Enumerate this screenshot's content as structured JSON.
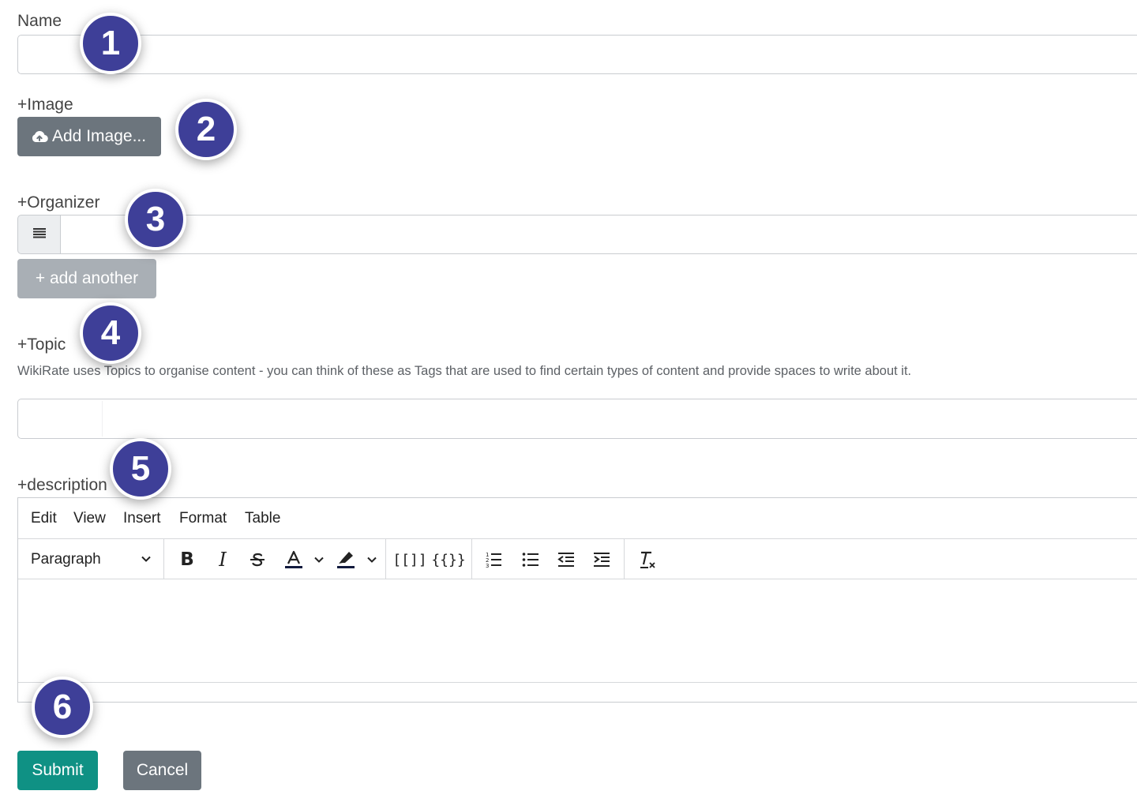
{
  "fields": {
    "name": {
      "label": "Name",
      "value": ""
    },
    "image": {
      "label": "+Image",
      "button_label": "Add Image..."
    },
    "organizer": {
      "label": "+Organizer",
      "value": "",
      "add_another_label": "+ add another"
    },
    "topic": {
      "label": "+Topic",
      "help_text": "WikiRate uses Topics to organise content - you can think of these as Tags that are used to find certain types of content and provide spaces to write about it.",
      "value": ""
    },
    "description": {
      "label": "+description"
    }
  },
  "editor": {
    "menu": [
      "Edit",
      "View",
      "Insert",
      "Format",
      "Table"
    ],
    "block_format": "Paragraph",
    "toolbar_icons": [
      "bold-icon",
      "italic-icon",
      "strikethrough-icon",
      "text-color-icon",
      "highlight-color-icon",
      "wiki-link-icon",
      "nest-icon",
      "numbered-list-icon",
      "bullet-list-icon",
      "outdent-icon",
      "indent-icon",
      "clear-formatting-icon"
    ],
    "link_label": "[[]]",
    "nest_label": "{{}}",
    "content": ""
  },
  "actions": {
    "submit_label": "Submit",
    "cancel_label": "Cancel"
  },
  "badges": [
    "1",
    "2",
    "3",
    "4",
    "5",
    "6"
  ],
  "colors": {
    "badge": "#3e3f98",
    "submit": "#0f9184",
    "cancel": "#6c757d",
    "image_button": "#6c757d",
    "add_another": "#a9afb5"
  }
}
